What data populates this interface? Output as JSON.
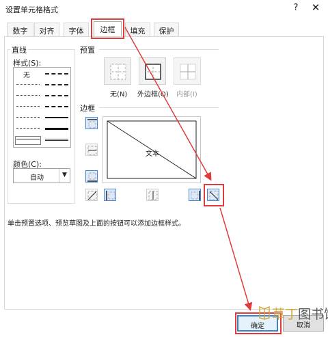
{
  "window": {
    "title": "设置单元格格式",
    "help_glyph": "?",
    "close_glyph": "✕"
  },
  "tabs": [
    {
      "label": "数字"
    },
    {
      "label": "对齐"
    },
    {
      "label": "字体"
    },
    {
      "label": "边框",
      "active": true
    },
    {
      "label": "填充"
    },
    {
      "label": "保护"
    }
  ],
  "line_section": {
    "group_label": "直线",
    "style_label": "样式(S):",
    "style_none": "无",
    "color_label": "颜色(C):",
    "color_value": "自动"
  },
  "presets": {
    "group_label": "预置",
    "items": [
      {
        "label": "无(N)",
        "icon": "border-none-icon"
      },
      {
        "label": "外边框(O)",
        "icon": "border-outline-icon"
      },
      {
        "label": "内部(I)",
        "icon": "border-inside-icon",
        "disabled": true
      }
    ]
  },
  "border": {
    "group_label": "边框",
    "preview_text": "文本",
    "buttons": [
      {
        "name": "top-border",
        "on": true
      },
      {
        "name": "inside-horizontal-border",
        "on": false
      },
      {
        "name": "bottom-border",
        "on": true
      },
      {
        "name": "diagonal-up-border",
        "on": false
      },
      {
        "name": "left-border",
        "on": true
      },
      {
        "name": "inside-vertical-border",
        "on": false
      },
      {
        "name": "right-border",
        "on": true
      },
      {
        "name": "diagonal-down-border",
        "on": true
      }
    ]
  },
  "help_text": "单击预置选项、预览草图及上面的按钮可以添加边框样式。",
  "actions": {
    "ok": "确定",
    "cancel": "取消"
  },
  "watermark": {
    "text_gold": "草丁",
    "text_dark": "图书馆"
  },
  "colors": {
    "annotation_red": "#e03b3b",
    "selected_blue": "#4a86d6"
  }
}
